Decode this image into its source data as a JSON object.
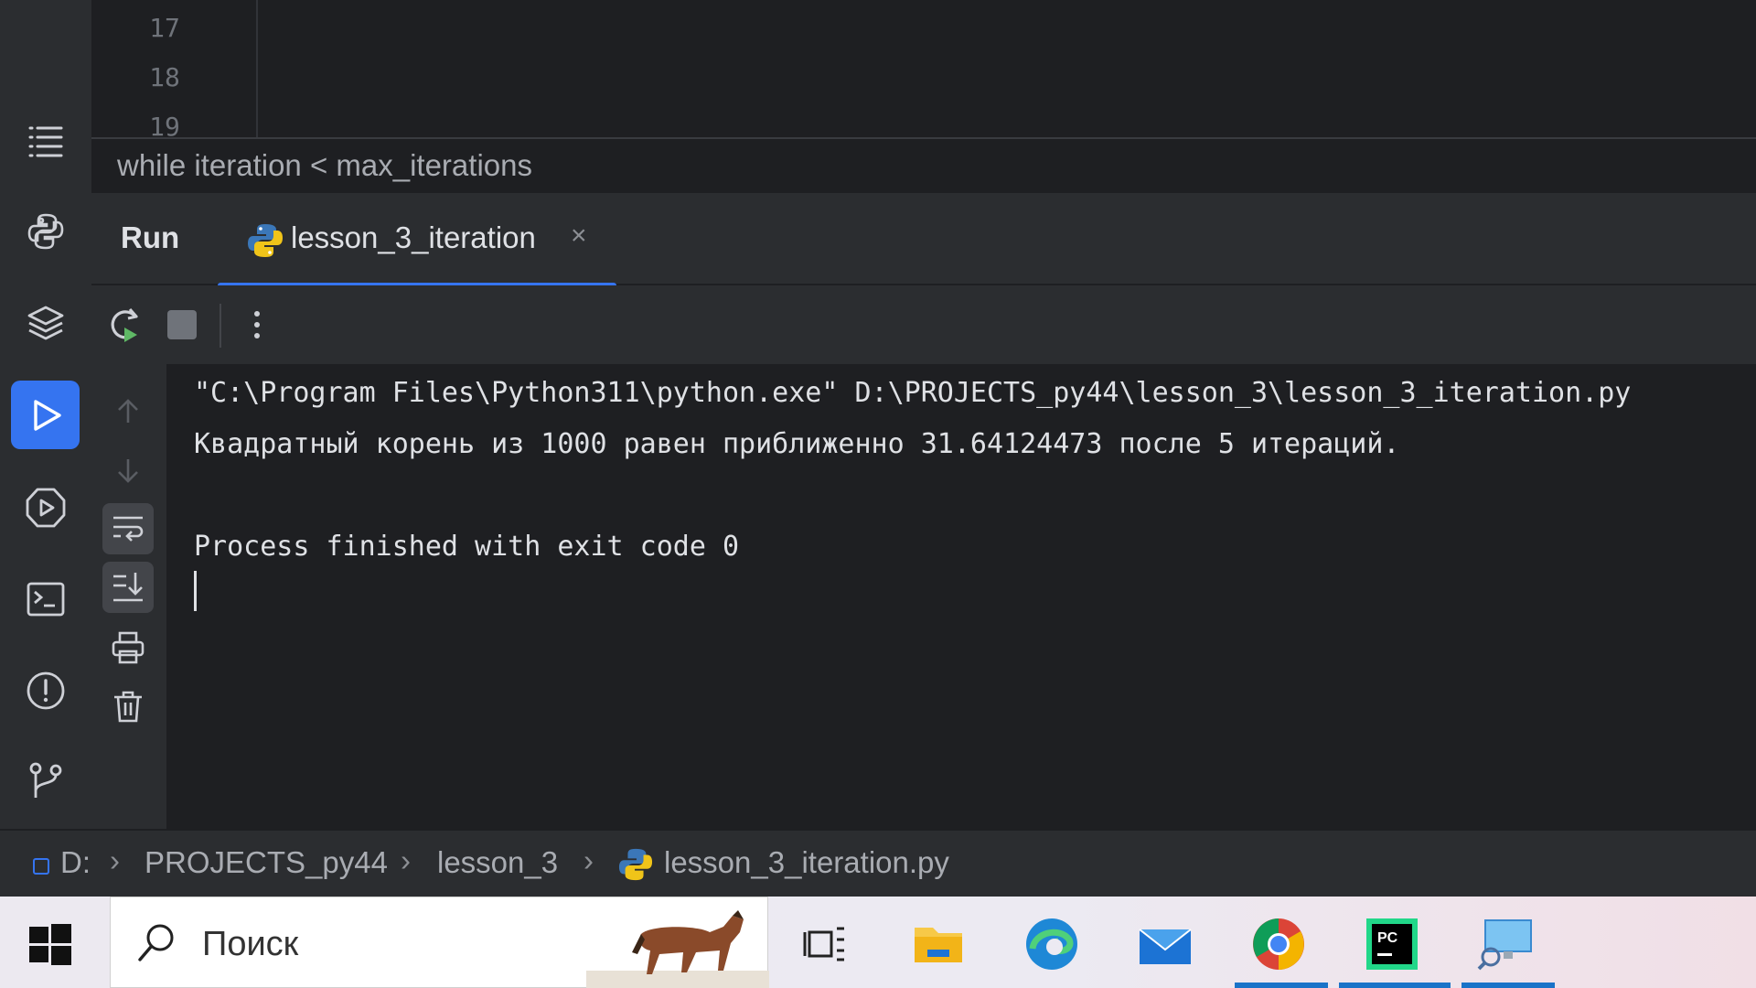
{
  "editor": {
    "line_numbers": [
      "17",
      "18",
      "19"
    ],
    "breadcrumb": "while iteration < max_iterations"
  },
  "run_panel": {
    "title": "Run",
    "tab_label": "lesson_3_iteration",
    "tab_close": "×"
  },
  "console": {
    "lines": [
      "\"C:\\Program Files\\Python311\\python.exe\" D:\\PROJECTS_py44\\lesson_3\\lesson_3_iteration.py",
      "Квадратный корень из 1000 равен приближенно 31.64124473 после 5 итераций.",
      "",
      "Process finished with exit code 0"
    ]
  },
  "status_bar": {
    "path": [
      "D:",
      "PROJECTS_py44",
      "lesson_3",
      "lesson_3_iteration.py"
    ],
    "separator": "›"
  },
  "taskbar": {
    "search_placeholder": "Поиск",
    "apps": [
      "task-view-icon",
      "file-explorer-icon",
      "edge-icon",
      "mail-icon",
      "chrome-icon",
      "pycharm-icon",
      "remote-desktop-icon"
    ]
  },
  "colors": {
    "accent": "#3574f0",
    "panel": "#2b2d30",
    "editor_bg": "#1e1f22"
  }
}
